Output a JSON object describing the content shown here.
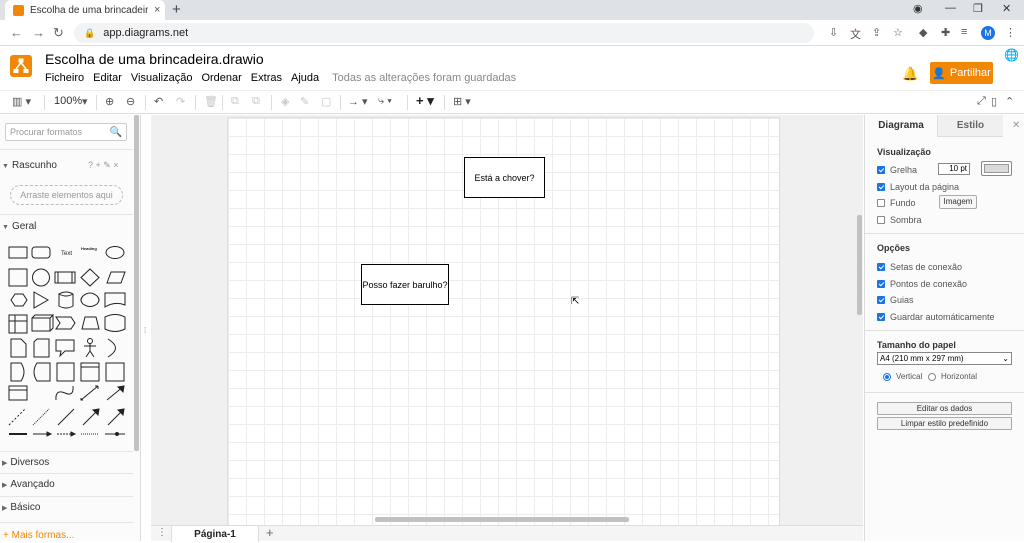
{
  "browser": {
    "tab_title": "Escolha de uma brincadeira.drawio",
    "tab_close": "×",
    "new_tab": "+",
    "url": "app.diagrams.net",
    "profile_initial": "M"
  },
  "app": {
    "doc_title": "Escolha de uma brincadeira.drawio",
    "menu": [
      "Ficheiro",
      "Editar",
      "Visualização",
      "Ordenar",
      "Extras",
      "Ajuda"
    ],
    "save_status": "Todas as alterações foram guardadas",
    "share_label": "Partilhar",
    "accent": "#f08705"
  },
  "toolbar": {
    "zoom": "100%"
  },
  "left": {
    "search_placeholder": "Procurar formatos",
    "scratch_title": "Rascunho",
    "scratch_tools": "? + ✎ ×",
    "drop_hint": "Arraste elementos aqui",
    "general_title": "Geral",
    "sections": [
      "Diversos",
      "Avançado",
      "Básico"
    ],
    "more_shapes": "+ Mais formas...",
    "shape_text": "Text",
    "shape_heading": "Heading"
  },
  "canvas": {
    "nodes": [
      {
        "label": "Está a chover?"
      },
      {
        "label": "Posso fazer barulho?"
      }
    ],
    "page_tab": "Página-1"
  },
  "right": {
    "tab_diagram": "Diagrama",
    "tab_style": "Estilo",
    "view_title": "Visualização",
    "grid_label": "Grelha",
    "grid_size": "10 pt",
    "page_view_label": "Layout da página",
    "background_label": "Fundo",
    "image_button": "Imagem",
    "shadow_label": "Sombra",
    "options_title": "Opções",
    "connection_arrows": "Setas de conexão",
    "connection_points": "Pontos de conexão",
    "guides": "Guias",
    "autosave": "Guardar automáticamente",
    "paper_title": "Tamanho do papel",
    "paper_size": "A4 (210 mm x 297 mm)",
    "portrait": "Vertical",
    "landscape": "Horizontal",
    "edit_data": "Editar os dados",
    "clear_style": "Limpar estilo predefinido",
    "checks": {
      "grid": true,
      "page_view": true,
      "background": false,
      "shadow": false,
      "connection_arrows": true,
      "connection_points": true,
      "guides": true,
      "autosave": true
    },
    "orientation": "portrait"
  }
}
